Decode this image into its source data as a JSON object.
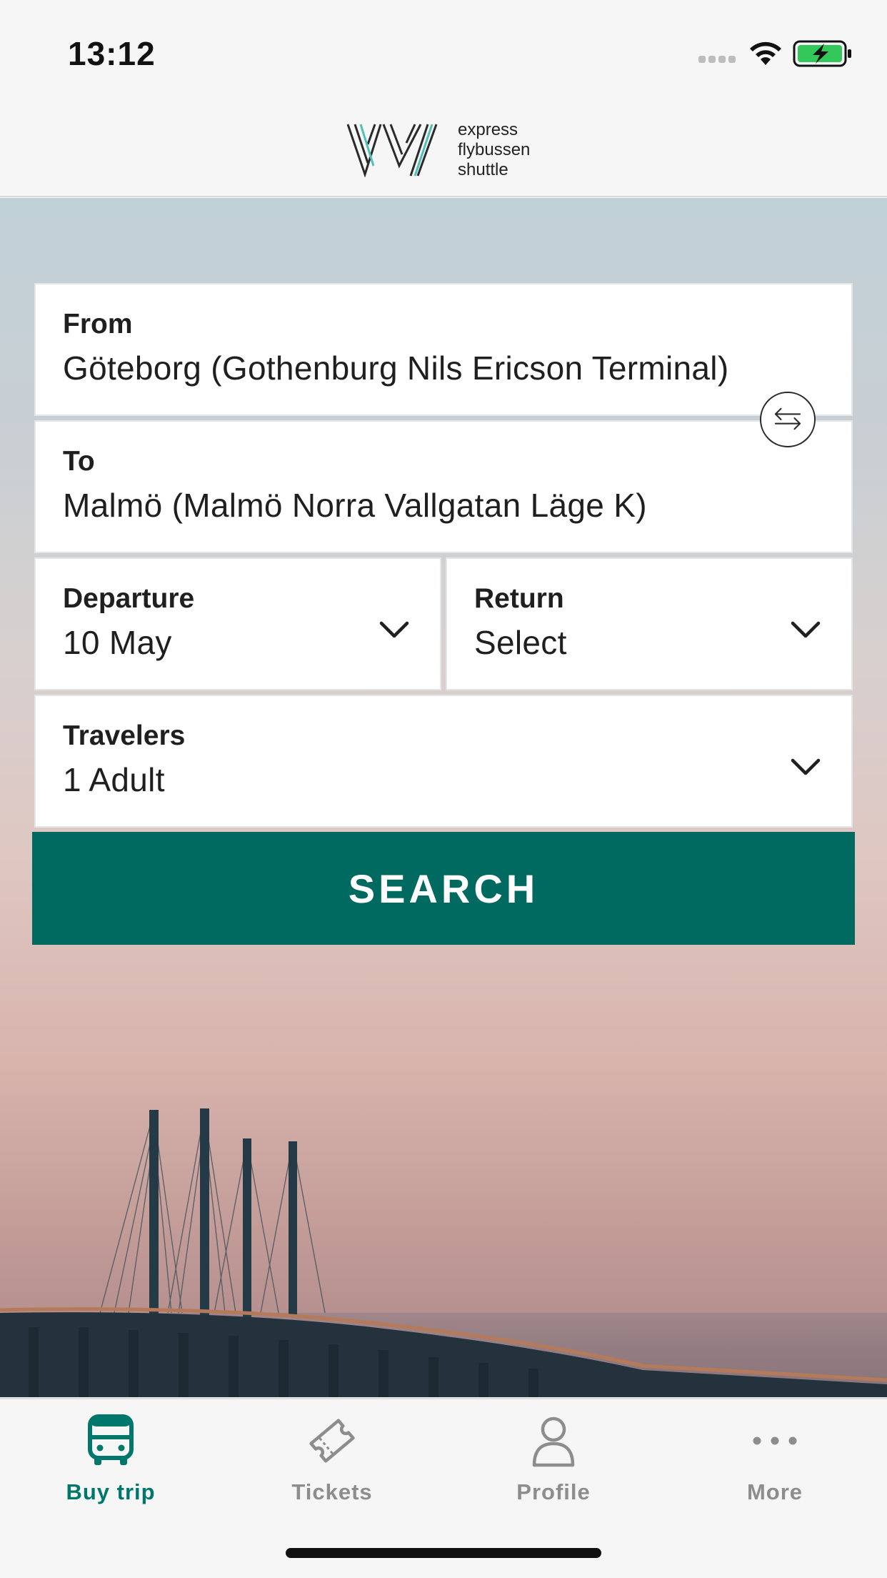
{
  "status_bar": {
    "time": "13:12",
    "battery_color": "#34c759"
  },
  "header": {
    "logo_icon": "vy-logo-icon",
    "logo_lines": [
      "express",
      "flybussen",
      "shuttle"
    ]
  },
  "search_form": {
    "from": {
      "label": "From",
      "value": "Göteborg (Gothenburg Nils Ericson Terminal)"
    },
    "to": {
      "label": "To",
      "value": "Malmö (Malmö Norra Vallgatan Läge K)"
    },
    "swap_icon": "swap-arrows-icon",
    "departure": {
      "label": "Departure",
      "value": "10 May"
    },
    "return": {
      "label": "Return",
      "value": "Select"
    },
    "travelers": {
      "label": "Travelers",
      "value": "1 Adult"
    },
    "search_label": "SEARCH"
  },
  "tabbar": {
    "active_color": "#00776b",
    "items": [
      {
        "label": "Buy trip",
        "icon": "bus-icon",
        "active": true
      },
      {
        "label": "Tickets",
        "icon": "ticket-icon",
        "active": false
      },
      {
        "label": "Profile",
        "icon": "person-icon",
        "active": false
      },
      {
        "label": "More",
        "icon": "more-dots-icon",
        "active": false
      }
    ]
  },
  "colors": {
    "accent": "#006a60",
    "background": "#f6f6f6"
  }
}
